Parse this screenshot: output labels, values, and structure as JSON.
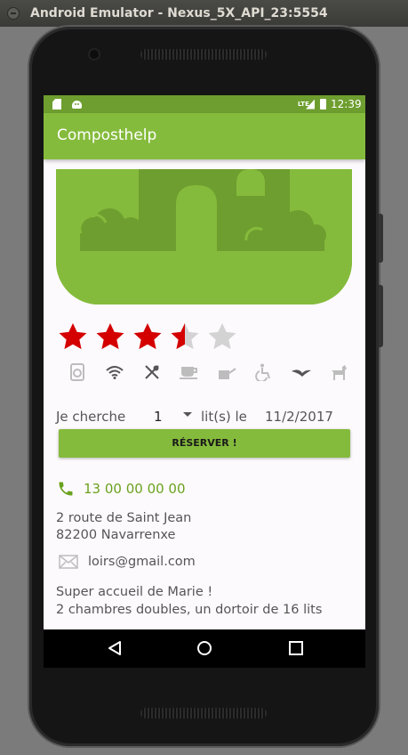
{
  "window": {
    "title": "Android Emulator - Nexus_5X_API_23:5554"
  },
  "statusbar": {
    "time": "12:39",
    "network": "LTE"
  },
  "app": {
    "title": "Composthelp"
  },
  "rating": {
    "value": 3.5,
    "max": 5
  },
  "amenities": [
    {
      "icon": "washing-machine-icon",
      "active": false
    },
    {
      "icon": "wifi-icon",
      "active": true
    },
    {
      "icon": "restaurant-icon",
      "active": true
    },
    {
      "icon": "coffee-cup-icon",
      "active": false
    },
    {
      "icon": "watering-can-icon",
      "active": false
    },
    {
      "icon": "wheelchair-icon",
      "active": false
    },
    {
      "icon": "bird-icon",
      "active": true
    },
    {
      "icon": "dog-icon",
      "active": false
    }
  ],
  "booking": {
    "label": "Je cherche",
    "count": "1",
    "unit": "lit(s) le",
    "date": "11/2/2017",
    "reserve_label": "RÉSERVER !"
  },
  "contact": {
    "phone": "13 00 00 00 00",
    "address_line1": "2 route de Saint Jean",
    "address_line2": "82200  Navarrenxe",
    "email": "loirs@gmail.com"
  },
  "description": {
    "line1": "Super accueil de Marie !",
    "line2": "2 chambres doubles, un dortoir de 16 lits"
  },
  "colors": {
    "primary": "#85bb3c",
    "primary_dark": "#6e9e2f",
    "star": "#d40000",
    "star_empty": "#d3d3d3"
  }
}
